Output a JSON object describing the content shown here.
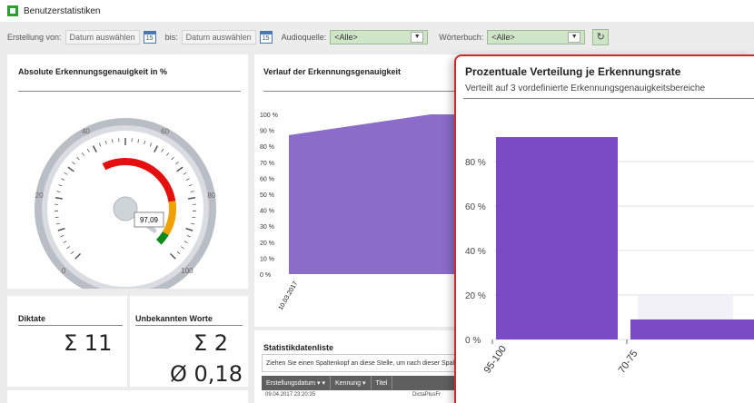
{
  "window": {
    "title": "Benutzerstatistiken"
  },
  "filters": {
    "from_label": "Erstellung von:",
    "from_value": "Datum auswählen",
    "to_label": "bis:",
    "to_value": "Datum auswählen",
    "calendar_day": "15",
    "audio_label": "Audioquelle:",
    "audio_value": "<Alle>",
    "dict_label": "Wörterbuch:",
    "dict_value": "<Alle>",
    "dropdown_glyph": "▼",
    "refresh_glyph": "↻"
  },
  "gauge": {
    "title": "Absolute Erkennungsgenauigkeit in %",
    "value": 97.09,
    "value_label": "97,09",
    "ticks": [
      "0",
      "20",
      "40",
      "60",
      "80",
      "100"
    ]
  },
  "stats": {
    "diktate_label": "Diktate",
    "diktate_value": "Σ 11",
    "unknown_label": "Unbekannten Worte",
    "unknown_sum": "Σ 2",
    "unknown_avg": "Ø 0,18"
  },
  "trend": {
    "title": "Verlauf der Erkennungsgenauigkeit",
    "y_ticks": [
      "100 %",
      "90 %",
      "80 %",
      "70 %",
      "60 %",
      "50 %",
      "40 %",
      "30 %",
      "20 %",
      "10 %",
      "0 %"
    ],
    "x_label": "10.03.2017",
    "fill_color": "#8b6cc9"
  },
  "grid": {
    "title": "Statistikdatenliste",
    "hint": "Ziehen Sie einen Spaltenkopf an diese Stelle, um nach dieser Spalte zu gruppieren",
    "col_date": "Erstellungsdatum",
    "col_id": "Kennung",
    "col_title": "Titel",
    "row_date": "09.04.2017 23:20:35",
    "row_title": "DictaPlusFr"
  },
  "chart_data": {
    "type": "bar",
    "title": "Prozentuale Verteilung je Erkennungsrate",
    "subtitle": "Verteilt auf 3 vordefinierte Erkennungsgenauigkeitsbereiche",
    "categories": [
      "95-100",
      "70-75"
    ],
    "values": [
      91,
      9
    ],
    "ylim": [
      0,
      100
    ],
    "y_ticks": [
      "0 %",
      "20 %",
      "40 %",
      "60 %",
      "80 %"
    ],
    "bar_color": "#7a4bc4"
  }
}
